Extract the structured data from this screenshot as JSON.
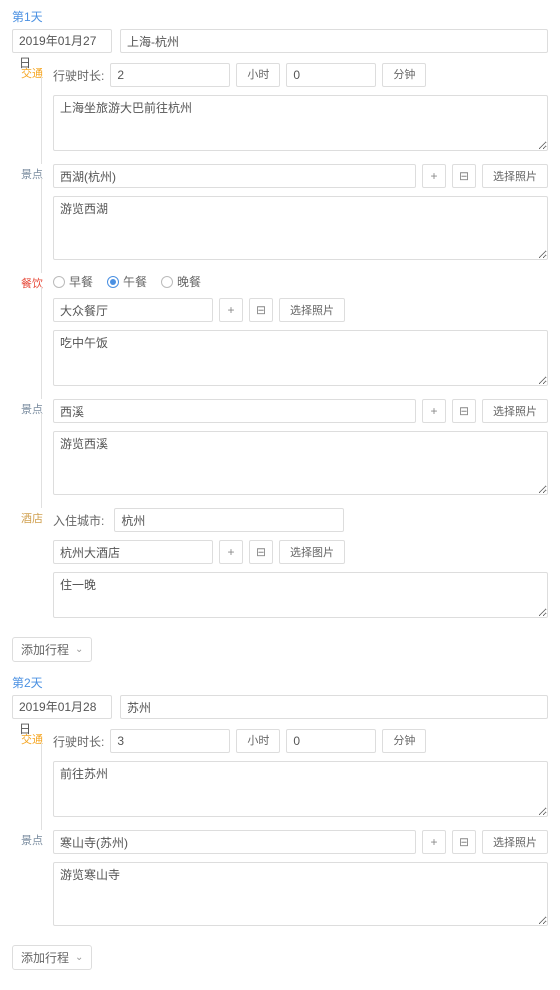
{
  "labels": {
    "duration": "行驶时长:",
    "hour": "小时",
    "minute": "分钟",
    "selectPhoto": "选择照片",
    "selectImage": "选择图片",
    "addTrip": "添加行程",
    "checkinCity": "入住城市:"
  },
  "sections": {
    "traffic": "交通",
    "spot": "景点",
    "meal": "餐饮",
    "hotel": "酒店"
  },
  "meals": {
    "breakfast": "早餐",
    "lunch": "午餐",
    "dinner": "晚餐"
  },
  "day1": {
    "label": "第1天",
    "date": "2019年01月27日",
    "title": "上海-杭州",
    "traffic": {
      "hours": "2",
      "minutes": "0",
      "desc": "上海坐旅游大巴前往杭州"
    },
    "spot1": {
      "name": "西湖(杭州)",
      "desc": "游览西湖"
    },
    "meal": {
      "restaurant": "大众餐厅",
      "desc": "吃中午饭"
    },
    "spot2": {
      "name": "西溪",
      "desc": "游览西溪"
    },
    "hotel": {
      "city": "杭州",
      "name": "杭州大酒店",
      "desc": "住一晚"
    }
  },
  "day2": {
    "label": "第2天",
    "date": "2019年01月28日",
    "title": "苏州",
    "traffic": {
      "hours": "3",
      "minutes": "0",
      "desc": "前往苏州"
    },
    "spot1": {
      "name": "寒山寺(苏州)",
      "desc": "游览寒山寺"
    }
  }
}
